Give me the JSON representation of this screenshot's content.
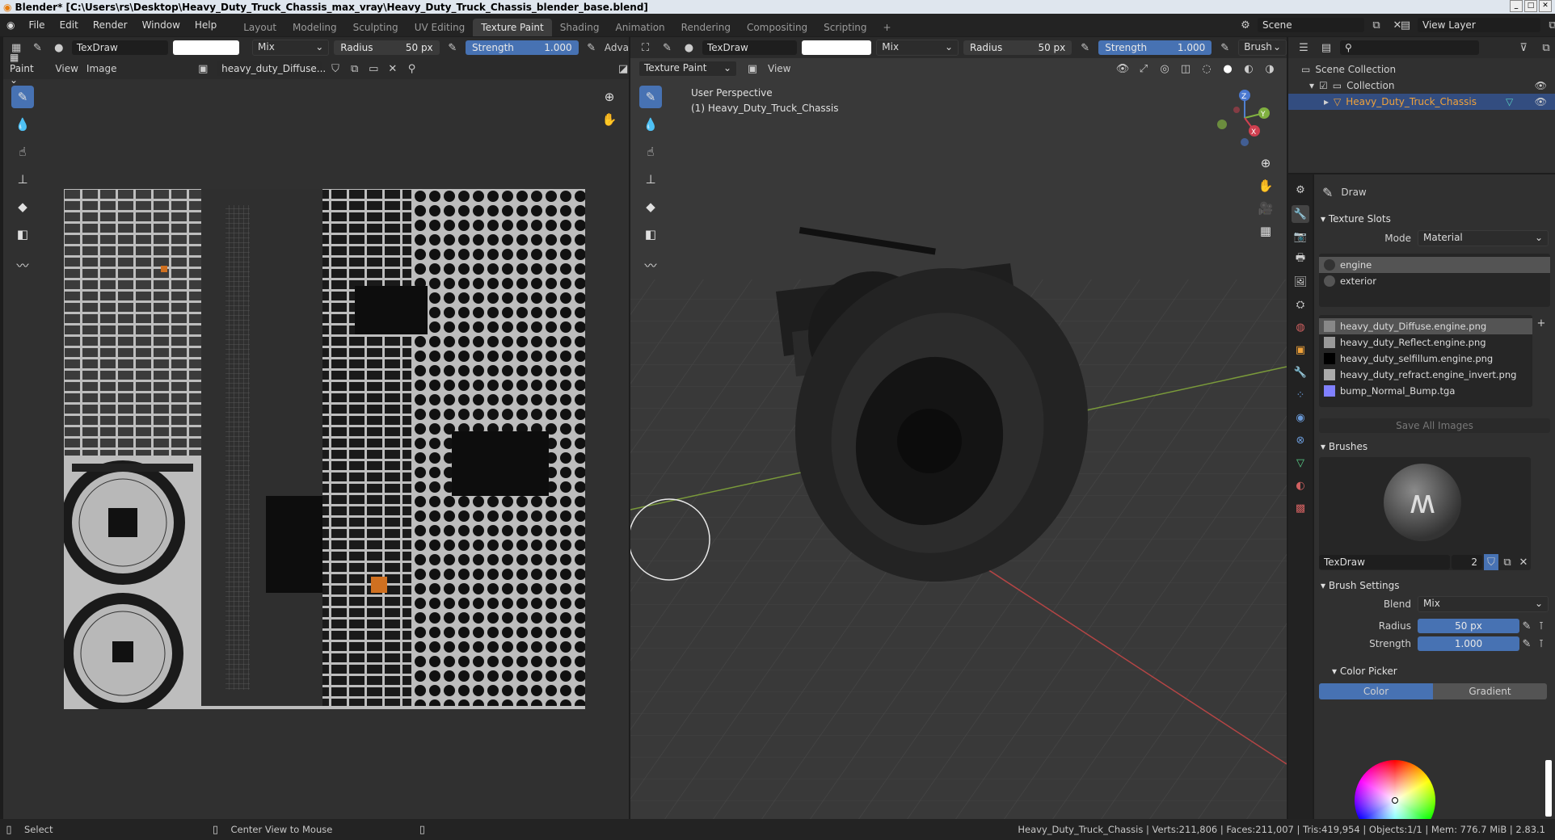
{
  "window": {
    "title": "Blender* [C:\\Users\\rs\\Desktop\\Heavy_Duty_Truck_Chassis_max_vray\\Heavy_Duty_Truck_Chassis_blender_base.blend]"
  },
  "menu": [
    "File",
    "Edit",
    "Render",
    "Window",
    "Help"
  ],
  "workspaces": [
    "Layout",
    "Modeling",
    "Sculpting",
    "UV Editing",
    "Texture Paint",
    "Shading",
    "Animation",
    "Rendering",
    "Compositing",
    "Scripting"
  ],
  "active_workspace": "Texture Paint",
  "scene": {
    "name": "Scene",
    "view_layer": "View Layer"
  },
  "image_editor": {
    "brush_name": "TexDraw",
    "blend": "Mix",
    "radius_label": "Radius",
    "radius_value": "50 px",
    "strength_label": "Strength",
    "strength_value": "1.000",
    "adv_label": "Adva",
    "mode": "Paint",
    "view": "View",
    "image_menu": "Image",
    "image_name": "heavy_duty_Diffuse..."
  },
  "viewport": {
    "brush_name": "TexDraw",
    "blend": "Mix",
    "radius_label": "Radius",
    "radius_value": "50 px",
    "strength_label": "Strength",
    "strength_value": "1.000",
    "brush_menu": "Brush",
    "mode": "Texture Paint",
    "view": "View",
    "overlay_title": "User Perspective",
    "overlay_object": "(1) Heavy_Duty_Truck_Chassis",
    "gizmo": {
      "x": "X",
      "y": "Y",
      "z": "Z"
    }
  },
  "outliner": {
    "scene_collection": "Scene Collection",
    "collection": "Collection",
    "object": "Heavy_Duty_Truck_Chassis"
  },
  "properties": {
    "tool_name": "Draw",
    "texture_slots": {
      "title": "Texture Slots",
      "mode_label": "Mode",
      "mode_value": "Material",
      "materials": [
        "engine",
        "exterior"
      ],
      "images": [
        "heavy_duty_Diffuse.engine.png",
        "heavy_duty_Reflect.engine.png",
        "heavy_duty_selfillum.engine.png",
        "heavy_duty_refract.engine_invert.png",
        "bump_Normal_Bump.tga"
      ],
      "save_all": "Save All Images"
    },
    "brushes": {
      "title": "Brushes",
      "brush_name": "TexDraw",
      "users": "2"
    },
    "brush_settings": {
      "title": "Brush Settings",
      "blend_label": "Blend",
      "blend_value": "Mix",
      "radius_label": "Radius",
      "radius_value": "50 px",
      "strength_label": "Strength",
      "strength_value": "1.000"
    },
    "color_picker": {
      "title": "Color Picker",
      "tab_color": "Color",
      "tab_gradient": "Gradient"
    }
  },
  "statusbar": {
    "select": "Select",
    "center_view": "Center View to Mouse",
    "stats": "Heavy_Duty_Truck_Chassis | Verts:211,806 | Faces:211,007 | Tris:419,954 | Objects:1/1 | Mem: 776.7 MiB | 2.83.1"
  },
  "colors": {
    "accent": "#4772b3",
    "panel": "#303030",
    "header": "#2b2b2b",
    "selected_object": "#f0a23a"
  }
}
